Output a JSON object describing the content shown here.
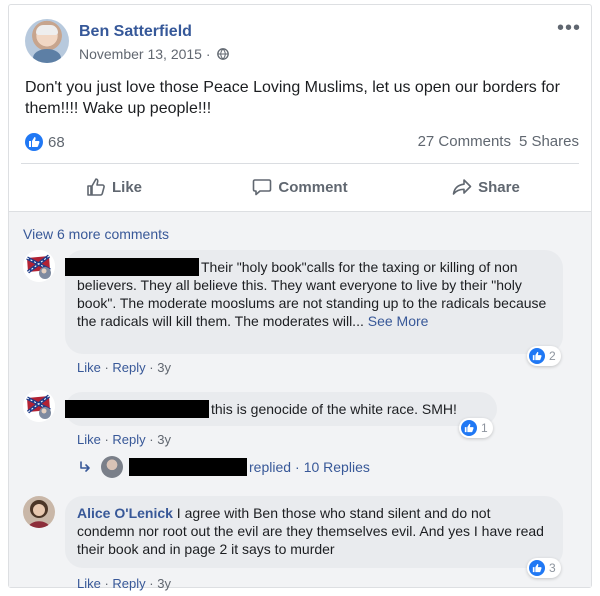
{
  "post": {
    "author": "Ben Satterfield",
    "date": "November 13, 2015 ·",
    "text": "Don't you just love those Peace Loving Muslims, let us open our borders for them!!!! Wake up people!!!",
    "like_count": "68",
    "comments_count": "27 Comments",
    "shares_count": "5 Shares"
  },
  "actions": {
    "like": "Like",
    "comment": "Comment",
    "share": "Share"
  },
  "view_more": "View 6 more comments",
  "comments": [
    {
      "text": "Their \"holy book\"calls for the taxing or killing of non believers. They all believe this. They want everyone to live by their \"holy book\". The moderate mooslums are not standing up to the radicals because the radicals will kill them. The moderates will...",
      "see_more": "See More",
      "like": "Like",
      "reply": "Reply",
      "time": "3y",
      "reactions": "2"
    },
    {
      "text": "this is genocide of the white race. SMH!",
      "like": "Like",
      "reply": "Reply",
      "time": "3y",
      "reactions": "1"
    },
    {
      "name": "Alice O'Lenick",
      "text": " I agree with Ben those who stand silent and do not condemn nor root out the evil are they themselves evil. And yes I have read their book and in page 2 it says to murder",
      "like": "Like",
      "reply": "Reply",
      "time": "3y",
      "reactions": "3"
    }
  ],
  "replies": {
    "text": "replied",
    "count": "10 Replies"
  },
  "colors": {
    "link": "#385898",
    "like_blue": "#2078f4",
    "comment_bg": "#f2f3f5",
    "bubble_bg": "#e9ebee"
  }
}
